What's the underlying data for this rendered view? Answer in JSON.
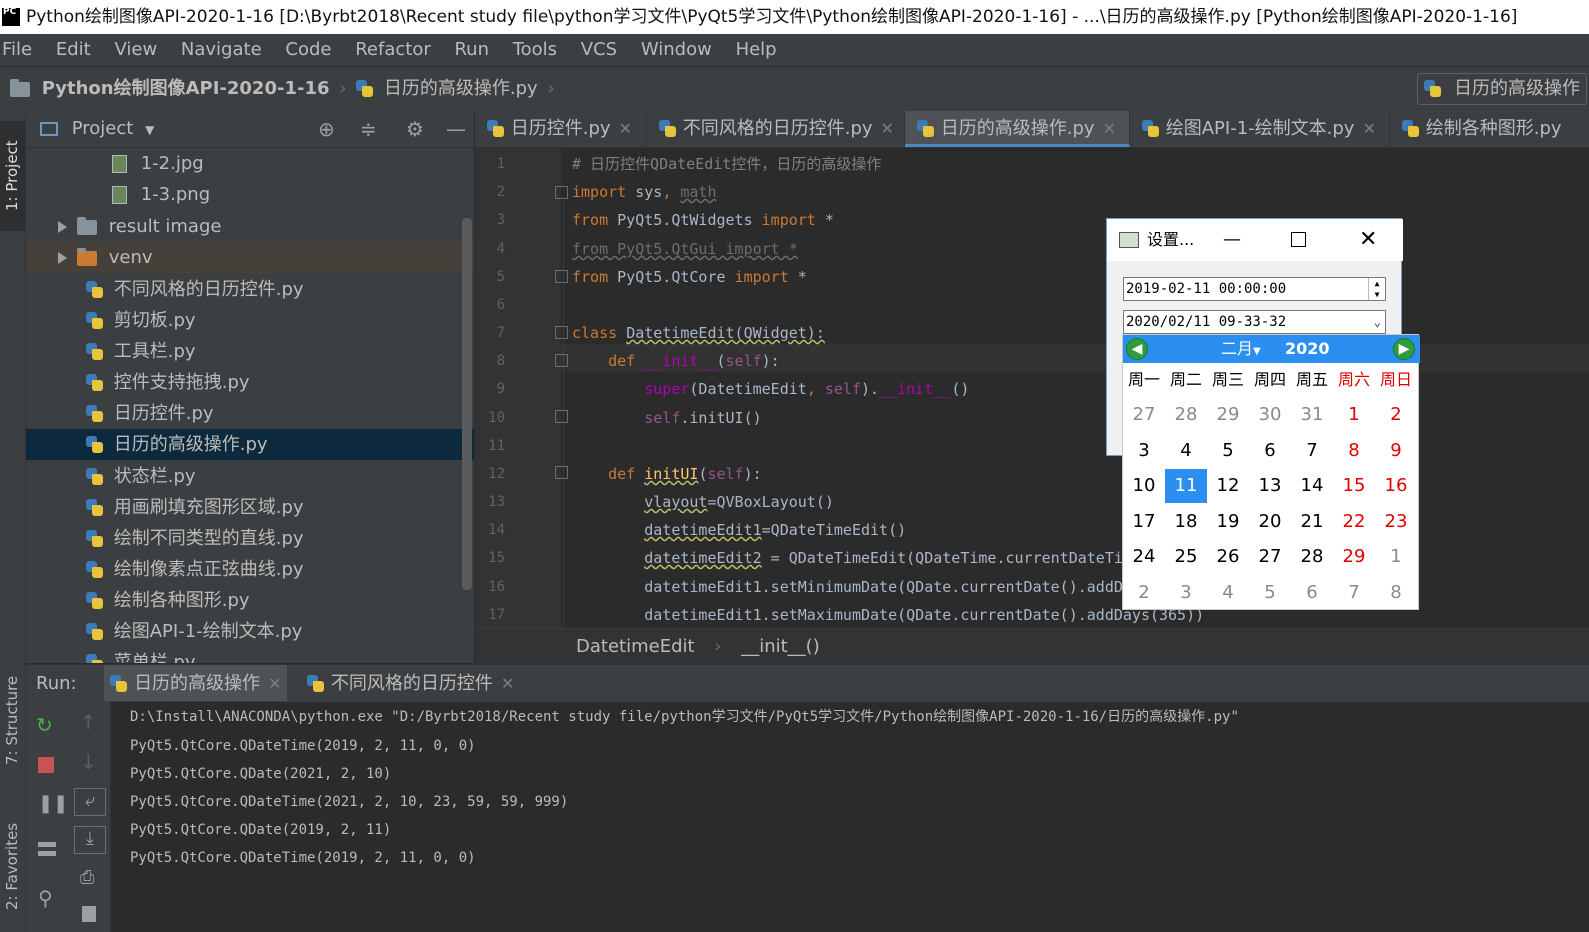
{
  "window": {
    "title": "Python绘制图像API-2020-1-16 [D:\\Byrbt2018\\Recent study file\\python学习文件\\PyQt5学习文件\\Python绘制图像API-2020-1-16] - ...\\日历的高级操作.py [Python绘制图像API-2020-1-16]",
    "app_icon_text": "PC"
  },
  "menu": [
    "File",
    "Edit",
    "View",
    "Navigate",
    "Code",
    "Refactor",
    "Run",
    "Tools",
    "VCS",
    "Window",
    "Help"
  ],
  "navbar": {
    "project": "Python绘制图像API-2020-1-16",
    "file": "日历的高级操作.py",
    "run_config": "日历的高级操作"
  },
  "left_stripe": {
    "project_tab": "1: Project",
    "structure_tab": "7: Structure",
    "favorites_tab": "2: Favorites"
  },
  "project_panel": {
    "title": "Project",
    "items": [
      {
        "label": "1-2.jpg",
        "type": "image"
      },
      {
        "label": "1-3.png",
        "type": "image"
      },
      {
        "label": "result image",
        "type": "folder"
      },
      {
        "label": "venv",
        "type": "folder"
      },
      {
        "label": "不同风格的日历控件.py",
        "type": "py"
      },
      {
        "label": "剪切板.py",
        "type": "py"
      },
      {
        "label": "工具栏.py",
        "type": "py"
      },
      {
        "label": "控件支持拖拽.py",
        "type": "py"
      },
      {
        "label": "日历控件.py",
        "type": "py"
      },
      {
        "label": "日历的高级操作.py",
        "type": "py"
      },
      {
        "label": "状态栏.py",
        "type": "py"
      },
      {
        "label": "用画刷填充图形区域.py",
        "type": "py"
      },
      {
        "label": "绘制不同类型的直线.py",
        "type": "py"
      },
      {
        "label": "绘制像素点正弦曲线.py",
        "type": "py"
      },
      {
        "label": "绘制各种图形.py",
        "type": "py"
      },
      {
        "label": "绘图API-1-绘制文本.py",
        "type": "py"
      },
      {
        "label": "菜单栏.py",
        "type": "py"
      }
    ]
  },
  "editor_tabs": [
    "日历控件.py",
    "不同风格的日历控件.py",
    "日历的高级操作.py",
    "绘图API-1-绘制文本.py",
    "绘制各种图形.py"
  ],
  "code_lines": [
    {
      "n": "1",
      "text": "# 日历控件QDateEdit控件，日历的高级操作"
    },
    {
      "n": "2",
      "text": "import sys, math"
    },
    {
      "n": "3",
      "text": "from PyQt5.QtWidgets import *"
    },
    {
      "n": "4",
      "text": "from PyQt5.QtGui import *"
    },
    {
      "n": "5",
      "text": "from PyQt5.QtCore import *"
    },
    {
      "n": "6",
      "text": ""
    },
    {
      "n": "7",
      "text": "class DatetimeEdit(QWidget):"
    },
    {
      "n": "8",
      "text": "    def __init__(self):"
    },
    {
      "n": "9",
      "text": "        super(DatetimeEdit, self).__init__()"
    },
    {
      "n": "10",
      "text": "        self.initUI()"
    },
    {
      "n": "11",
      "text": ""
    },
    {
      "n": "12",
      "text": "    def initUI(self):"
    },
    {
      "n": "13",
      "text": "        vlayout=QVBoxLayout()"
    },
    {
      "n": "14",
      "text": "        datetimeEdit1=QDateTimeEdit()"
    },
    {
      "n": "15",
      "text": "        datetimeEdit2 = QDateTimeEdit(QDateTime.currentDateTim"
    },
    {
      "n": "16",
      "text": "        datetimeEdit1.setMinimumDate(QDate.currentDate().addDa"
    },
    {
      "n": "17",
      "text": "        datetimeEdit1.setMaximumDate(QDate.currentDate().addDays(365))"
    }
  ],
  "breadcrumb": {
    "class": "DatetimeEdit",
    "method": "__init__()"
  },
  "run_panel": {
    "label": "Run:",
    "tabs": [
      "日历的高级操作",
      "不同风格的日历控件"
    ],
    "output": [
      "D:\\Install\\ANACONDA\\python.exe \"D:/Byrbt2018/Recent study file/python学习文件/PyQt5学习文件/Python绘制图像API-2020-1-16/日历的高级操作.py\"",
      "PyQt5.QtCore.QDateTime(2019, 2, 11, 0, 0)",
      "PyQt5.QtCore.QDate(2021, 2, 10)",
      "PyQt5.QtCore.QDateTime(2021, 2, 10, 23, 59, 59, 999)",
      "PyQt5.QtCore.QDate(2019, 2, 11)",
      "PyQt5.QtCore.QDateTime(2019, 2, 11, 0, 0)"
    ]
  },
  "popup": {
    "title": "设置...",
    "datetime1": "2019-02-11 00:00:00",
    "datetime2": "2020/02/11 09-33-32"
  },
  "calendar": {
    "month": "二月",
    "year": "2020",
    "weekdays": [
      "周一",
      "周二",
      "周三",
      "周四",
      "周五",
      "周六",
      "周日"
    ],
    "weeks": [
      [
        "27",
        "28",
        "29",
        "30",
        "31",
        "1",
        "2"
      ],
      [
        "3",
        "4",
        "5",
        "6",
        "7",
        "8",
        "9"
      ],
      [
        "10",
        "11",
        "12",
        "13",
        "14",
        "15",
        "16"
      ],
      [
        "17",
        "18",
        "19",
        "20",
        "21",
        "22",
        "23"
      ],
      [
        "24",
        "25",
        "26",
        "27",
        "28",
        "29",
        "1"
      ],
      [
        "2",
        "3",
        "4",
        "5",
        "6",
        "7",
        "8"
      ]
    ],
    "selected_day": "11",
    "weekend_color": "#e00000",
    "accent_color": "#2a8ff0"
  }
}
